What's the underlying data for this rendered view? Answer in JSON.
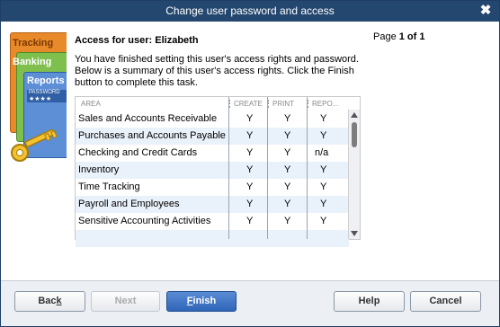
{
  "window": {
    "title": "Change user password and access",
    "close_glyph": "✖"
  },
  "illustration": {
    "labels": [
      "Tracking",
      "Banking",
      "Reports"
    ],
    "password_text": "PASSWORD",
    "password_mask": "★★★★",
    "icons": [
      "cards-icon",
      "key-icon"
    ]
  },
  "header": {
    "access_label": "Access for user: Elizabeth",
    "page_prefix": "Page ",
    "page_value": "1 of 1"
  },
  "intro_text": "You have finished setting this user's access rights and password. Below is a summary of this user's access rights.  Click the Finish button to complete this task.",
  "table": {
    "columns": [
      "AREA",
      "CREATE",
      "PRINT",
      "REPO..."
    ],
    "rows": [
      {
        "area": "Sales and Accounts Receivable",
        "create": "Y",
        "print": "Y",
        "reports": "Y"
      },
      {
        "area": "Purchases and Accounts Payable",
        "create": "Y",
        "print": "Y",
        "reports": "Y"
      },
      {
        "area": "Checking and Credit Cards",
        "create": "Y",
        "print": "Y",
        "reports": "n/a"
      },
      {
        "area": "Inventory",
        "create": "Y",
        "print": "Y",
        "reports": "Y"
      },
      {
        "area": "Time Tracking",
        "create": "Y",
        "print": "Y",
        "reports": "Y"
      },
      {
        "area": "Payroll and Employees",
        "create": "Y",
        "print": "Y",
        "reports": "Y"
      },
      {
        "area": "Sensitive Accounting Activities",
        "create": "Y",
        "print": "Y",
        "reports": "Y"
      },
      {
        "area": "",
        "create": "",
        "print": "",
        "reports": ""
      }
    ]
  },
  "buttons": {
    "back_pre": "Bac",
    "back_mn": "k",
    "back_post": "",
    "next": "Next",
    "finish_mn": "F",
    "finish_post": "inish",
    "help": "Help",
    "cancel": "Cancel"
  },
  "colors": {
    "titlebar": "#24476f",
    "finish_button": "#2f66b8",
    "row_alt": "#e9f1fa"
  }
}
